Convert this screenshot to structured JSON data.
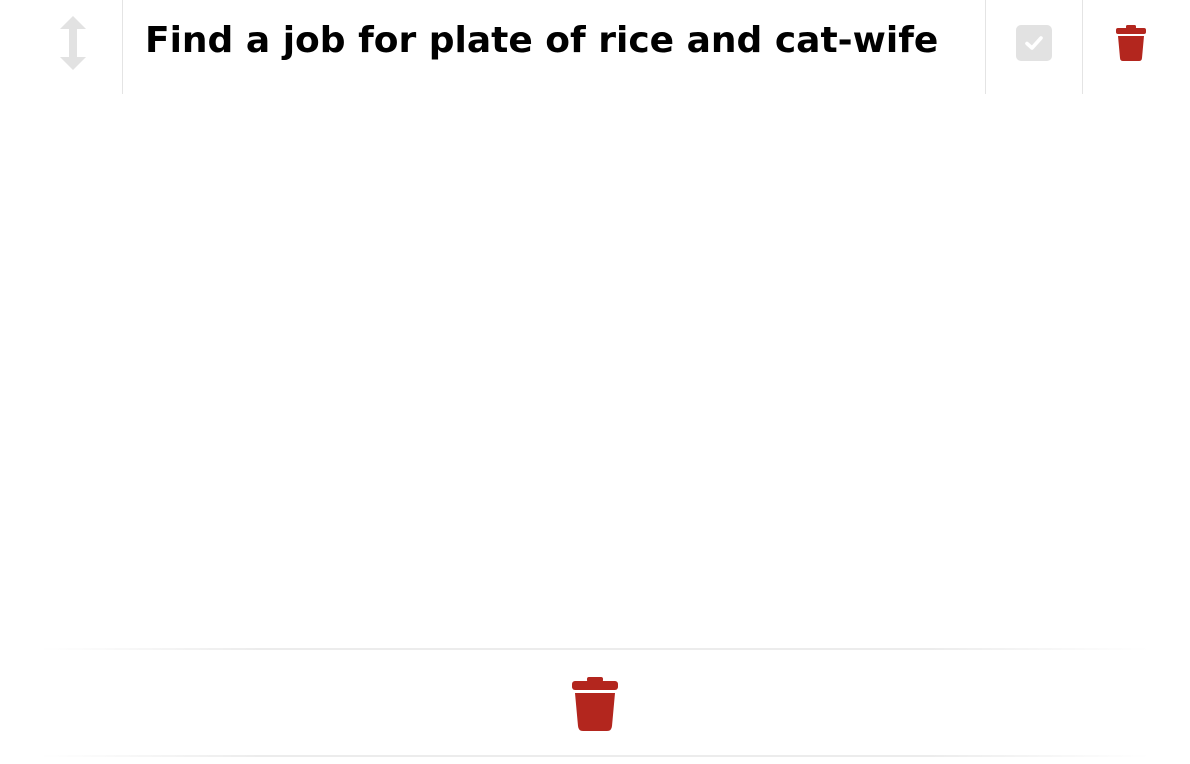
{
  "task": {
    "text": "Find a job for plate of rice and cat-wife",
    "completed": false,
    "icons": {
      "drag": "up-down-arrows-icon",
      "check": "check-icon",
      "delete": "trash-icon"
    }
  },
  "footer": {
    "icon": "trash-icon"
  },
  "colors": {
    "accent_red": "#b3261e",
    "muted_gray": "#e2e2e2",
    "divider": "#e4e4e4"
  }
}
